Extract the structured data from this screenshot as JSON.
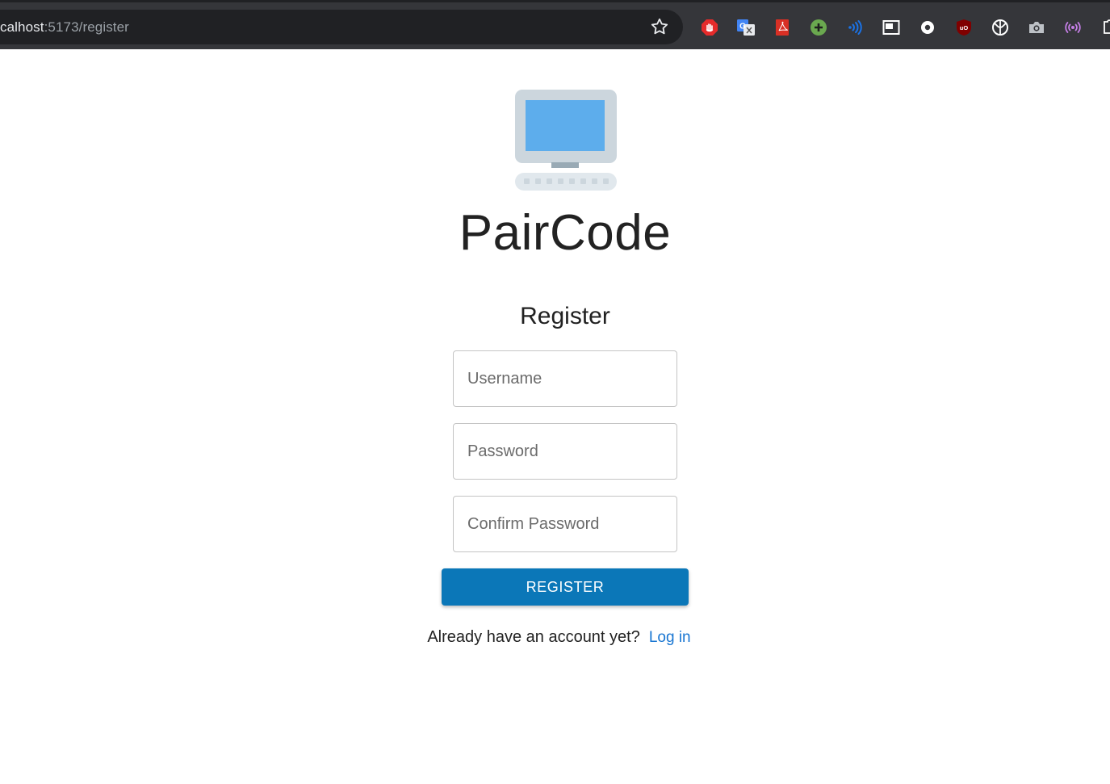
{
  "browser": {
    "url_host": "calhost",
    "url_path": ":5173/register",
    "extensions": [
      {
        "name": "adblock-icon",
        "color": "#e52b2b"
      },
      {
        "name": "google-translate-icon",
        "color": "#4285f4"
      },
      {
        "name": "pdf-icon",
        "color": "#d93025"
      },
      {
        "name": "plus-extension-icon",
        "color": "#6aa84f"
      },
      {
        "name": "read-aloud-icon",
        "color": "#1a73e8"
      },
      {
        "name": "picture-in-picture-icon",
        "color": "#ffffff"
      },
      {
        "name": "record-icon",
        "color": "#ffffff"
      },
      {
        "name": "ublock-icon",
        "color": "#800000"
      },
      {
        "name": "split-circle-icon",
        "color": "#ffffff"
      },
      {
        "name": "camera-icon",
        "color": "#bdc1c6"
      },
      {
        "name": "broadcast-icon",
        "color": "#c57fe6"
      },
      {
        "name": "puzzle-icon",
        "color": "#ffffff"
      }
    ]
  },
  "page": {
    "brand": "PairCode",
    "heading": "Register",
    "fields": {
      "username_placeholder": "Username",
      "password_placeholder": "Password",
      "confirm_placeholder": "Confirm Password"
    },
    "register_button": "REGISTER",
    "footer_text": "Already have an account yet?",
    "login_link": "Log in"
  },
  "colors": {
    "primary": "#0b77b8",
    "link": "#1976d2",
    "chrome_bg": "#35363a"
  }
}
